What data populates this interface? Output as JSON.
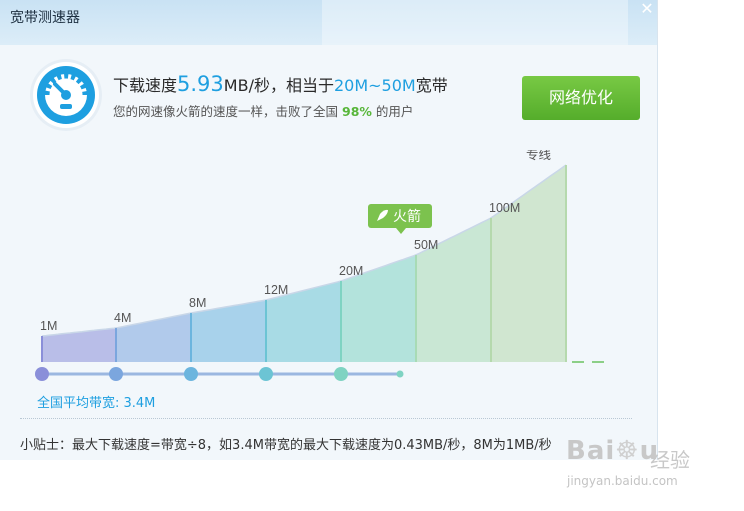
{
  "window": {
    "title": "宽带测速器",
    "close_glyph": "✕"
  },
  "result": {
    "prefix": "下载速度",
    "speed": "5.93",
    "unit_suffix": "MB/秒，相当于",
    "range": "20M~50M",
    "range_suffix": "宽带",
    "sub_prefix": "您的网速像火箭的速度一样，击败了全国",
    "percent": "98%",
    "sub_suffix": "的用户"
  },
  "optimize_button": {
    "label": "网络优化"
  },
  "chart": {
    "tiers": [
      "1M",
      "4M",
      "8M",
      "12M",
      "20M",
      "50M",
      "100M",
      "专线"
    ],
    "current_badge": "火箭",
    "colors": [
      "#8a8fd9",
      "#7ba6de",
      "#6cb5de",
      "#6cc4d4",
      "#7fd3c2",
      "#a8dbb5",
      "#b5d9ad"
    ],
    "line_color": "#8ccf87"
  },
  "average": {
    "label": "全国平均带宽: 3.4M"
  },
  "tip": {
    "text": "小贴士：最大下载速度=带宽÷8，如3.4M带宽的最大下载速度为0.43MB/秒，8M为1MB/秒"
  },
  "watermark": {
    "logo": "Baidu",
    "cn": "经验",
    "url": "jingyan.baidu.com"
  }
}
